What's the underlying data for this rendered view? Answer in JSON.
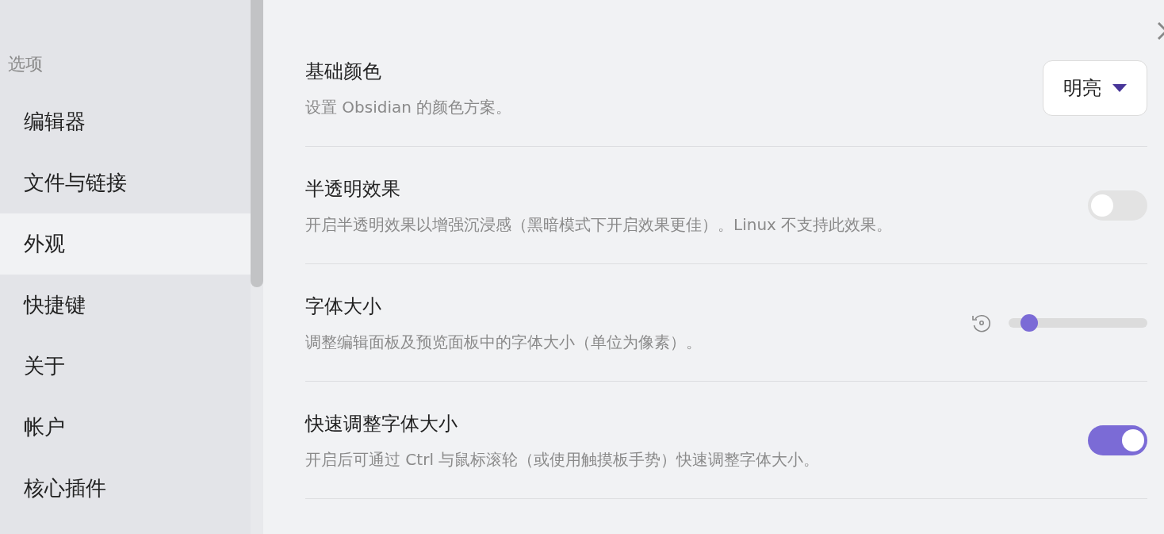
{
  "sidebar": {
    "heading": "选项",
    "items": [
      {
        "label": "编辑器",
        "selected": false
      },
      {
        "label": "文件与链接",
        "selected": false
      },
      {
        "label": "外观",
        "selected": true
      },
      {
        "label": "快捷键",
        "selected": false
      },
      {
        "label": "关于",
        "selected": false
      },
      {
        "label": "帐户",
        "selected": false
      },
      {
        "label": "核心插件",
        "selected": false
      }
    ]
  },
  "settings": [
    {
      "kind": "dropdown",
      "title": "基础颜色",
      "description": "设置 Obsidian 的颜色方案。",
      "value": "明亮"
    },
    {
      "kind": "toggle",
      "title": "半透明效果",
      "description": "开启半透明效果以增强沉浸感（黑暗模式下开启效果更佳）。Linux 不支持此效果。",
      "on": false
    },
    {
      "kind": "slider",
      "title": "字体大小",
      "description": "调整编辑面板及预览面板中的字体大小（单位为像素）。",
      "level": 0.1
    },
    {
      "kind": "toggle",
      "title": "快速调整字体大小",
      "description": "开启后可通过 Ctrl 与鼠标滚轮（或使用触摸板手势）快速调整字体大小。",
      "on": true
    }
  ]
}
